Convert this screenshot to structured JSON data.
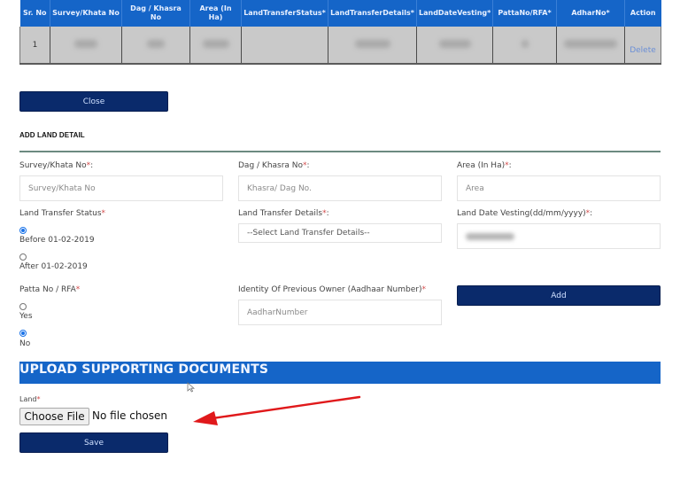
{
  "table": {
    "columns": [
      "Sr. No",
      "Survey/Khata No",
      "Dag / Khasra No",
      "Area (In Ha)",
      "LandTransferStatus*",
      "LandTransferDetails*",
      "LandDateVesting*",
      "PattaNo/RFA*",
      "AdharNo*",
      "Action"
    ],
    "rows": [
      {
        "sr_no": "1",
        "action_label": "Delete"
      }
    ]
  },
  "close_button": {
    "label": "Close"
  },
  "add_land_detail": {
    "title": "ADD LAND DETAIL",
    "survey_label": "Survey/Khata No",
    "survey_placeholder": "Survey/Khata No",
    "dag_label": "Dag / Khasra No",
    "dag_placeholder": "Khasra/ Dag No.",
    "area_label": "Area (In Ha)",
    "area_placeholder": "Area",
    "transfer_status_label": "Land Transfer Status",
    "transfer_status_options": [
      {
        "label": "Before 01-02-2019",
        "checked": true
      },
      {
        "label": "After 01-02-2019",
        "checked": false
      }
    ],
    "transfer_details_label": "Land Transfer Details",
    "transfer_details_selected": "--Select Land Transfer Details--",
    "date_vesting_label": "Land Date Vesting(dd/mm/yyyy)",
    "patta_label": "Patta No / RFA",
    "patta_options": [
      {
        "label": "Yes",
        "checked": false
      },
      {
        "label": "No",
        "checked": true
      }
    ],
    "aadhaar_label": "Identity Of Previous Owner (Aadhaar Number)",
    "aadhaar_placeholder": "AadharNumber",
    "add_button": "Add",
    "required_mark": "*",
    "colon": ":"
  },
  "upload": {
    "banner": "UPLOAD SUPPORTING DOCUMENTS",
    "land_label": "Land",
    "choose_file": "Choose File",
    "file_status": "No file chosen",
    "save_button": "Save"
  },
  "colors": {
    "header_blue": "#1565c8",
    "button_navy": "#0a2a6b",
    "required_red": "#d24a4a",
    "annotation_red": "#e0191b"
  }
}
